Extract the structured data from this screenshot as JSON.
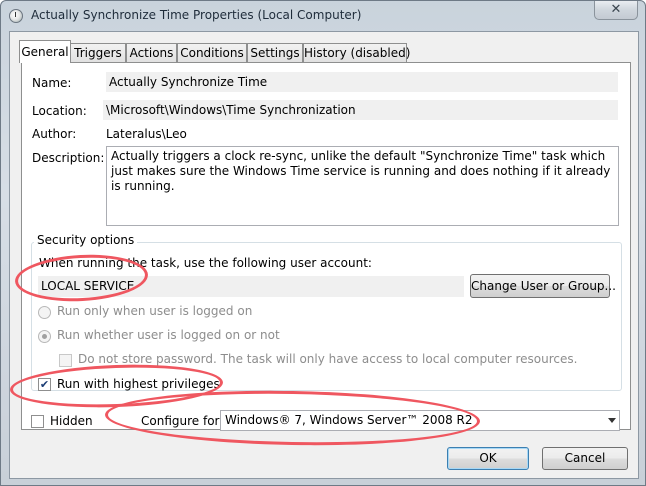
{
  "window": {
    "title": "Actually Synchronize Time Properties (Local Computer)",
    "close_glyph": "✕"
  },
  "tabs": [
    "General",
    "Triggers",
    "Actions",
    "Conditions",
    "Settings",
    "History (disabled)"
  ],
  "general": {
    "name_label": "Name:",
    "name_value": "Actually Synchronize Time",
    "location_label": "Location:",
    "location_value": "\\Microsoft\\Windows\\Time Synchronization",
    "author_label": "Author:",
    "author_value": "Lateralus\\Leo",
    "description_label": "Description:",
    "description_value": "Actually triggers a clock re-sync, unlike the default \"Synchronize Time\" task which just makes sure the Windows Time service is running and does nothing if it already is running."
  },
  "security": {
    "group_title": "Security options",
    "account_prompt": "When running the task, use the following user account:",
    "account_value": "LOCAL SERVICE",
    "change_button": "Change User or Group...",
    "radio_logged_on": "Run only when user is logged on",
    "radio_whether": "Run whether user is logged on or not",
    "no_store_password": "Do not store password.  The task will only have access to local computer resources.",
    "highest_privileges": "Run with highest privileges"
  },
  "bottom": {
    "hidden_label": "Hidden",
    "configure_label": "Configure for:",
    "configure_value": "Windows® 7, Windows Server™ 2008 R2",
    "ok_button": "OK",
    "cancel_button": "Cancel"
  },
  "colors": {
    "annotation": "#ef5760",
    "panel": "#ffffff",
    "dialog": "#f0f0f0"
  },
  "icons": {
    "title": "clock-icon",
    "checkmark": "✔"
  }
}
